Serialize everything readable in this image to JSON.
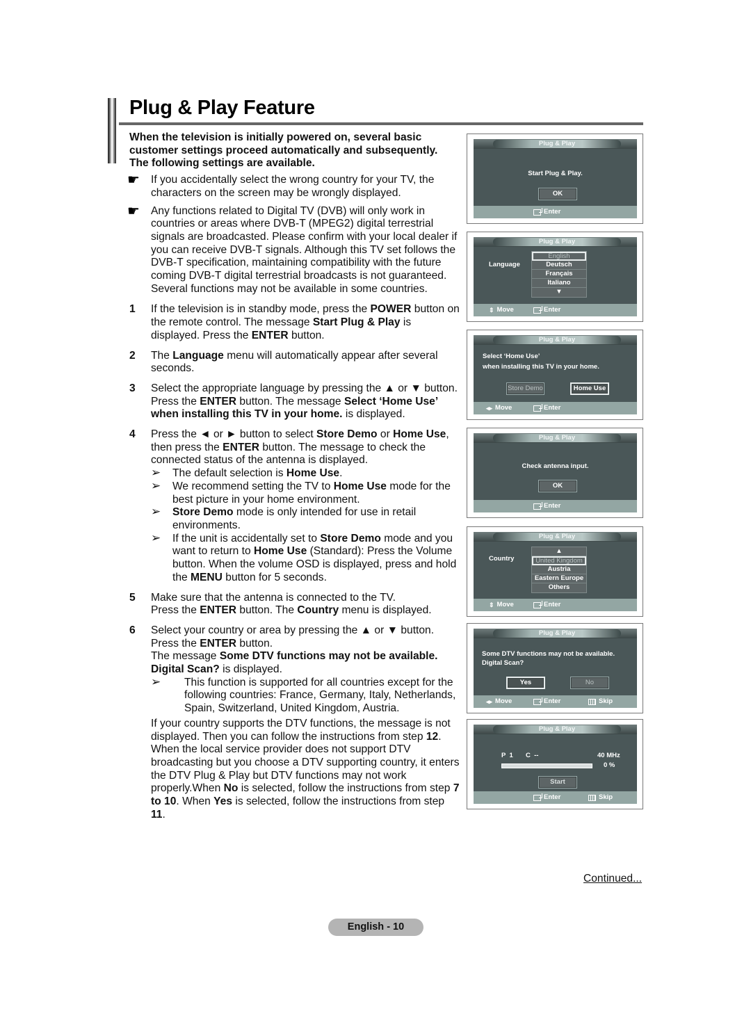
{
  "page": {
    "title": "Plug & Play Feature",
    "intro": "When the television is initially powered on, several basic customer settings proceed automatically and subsequently. The following settings are available.",
    "notes": [
      "If you accidentally select the wrong country for your TV, the characters on the screen may be wrongly displayed.",
      "Any functions related to Digital TV (DVB) will only work in countries or areas where DVB-T (MPEG2) digital terrestrial signals are broadcasted. Please confirm with your local dealer if you can receive DVB-T signals. Although this TV set follows the DVB-T specification, maintaining compatibility with the future coming DVB-T digital terrestrial broadcasts is not guaranteed. Several functions may not be available in some countries."
    ],
    "note_icon": "pointing-hand-icon",
    "steps": {
      "s1": {
        "num": "1",
        "a": "If the television is in standby mode, press the ",
        "b1": "POWER",
        "c": " button on the remote control. The message ",
        "b2": "Start Plug & Play",
        "d": " is displayed. Press the ",
        "b3": "ENTER",
        "e": " button."
      },
      "s2": {
        "num": "2",
        "a": "The ",
        "b1": "Language",
        "c": " menu will automatically appear after several seconds."
      },
      "s3": {
        "num": "3",
        "a": "Select the appropriate language by pressing the ▲ or ▼ button.",
        "p2a": "Press the ",
        "b1": "ENTER",
        "p2b": " button. The message ",
        "b2": "Select ‘Home Use’ when installing this TV in your home.",
        "p2c": " is displayed."
      },
      "s4": {
        "num": "4",
        "a": "Press the ◄ or ► button to select ",
        "b1": "Store Demo",
        "c": " or ",
        "b2": "Home Use",
        "d": ", then press the ",
        "b3": "ENTER",
        "e": " button. The message to check the connected status of the antenna is displayed.",
        "subs": {
          "n1": {
            "a": "The default selection is ",
            "b": "Home Use",
            "c": "."
          },
          "n2": {
            "a": "We recommend setting the TV to ",
            "b": "Home Use",
            "c": " mode for the best picture in your home environment."
          },
          "n3": {
            "b": "Store Demo",
            "c": " mode is only intended for use in retail environments."
          },
          "n4": {
            "a": "If the unit is accidentally set to ",
            "b1": "Store Demo",
            "c": " mode and you want to return to ",
            "b2": "Home Use",
            "d": " (Standard): Press the Volume button. When the volume OSD is displayed, press and hold the ",
            "b3": "MENU",
            "e": " button for 5 seconds."
          }
        }
      },
      "s5": {
        "num": "5",
        "a": "Make sure that the antenna is connected to the TV.",
        "p2a": "Press the ",
        "b1": "ENTER",
        "p2b": " button. The ",
        "b2": "Country",
        "p2c": " menu is displayed."
      },
      "s6": {
        "num": "6",
        "a": "Select your country or area by pressing the ▲ or ▼ button.",
        "p2a": "Press the ",
        "b1": "ENTER",
        "p2b": " button.",
        "p3a": "The message ",
        "b2": "Some DTV functions may not be available. Digital Scan?",
        "p3b": " is displayed.",
        "sub": "This function is supported for all countries except for the following countries: France, Germany, Italy, Netherlands, Spain, Switzerland, United Kingdom, Austria.",
        "para": {
          "a": "If your country supports the DTV functions, the message is not displayed. Then you can follow the instructions from step ",
          "b1": "12",
          "c": ". When the local service provider does not support DTV broadcasting but you choose a DTV supporting country, it enters the DTV Plug & Play but DTV functions may not work properly.When ",
          "b2": "No",
          "d": " is selected, follow the instructions from step ",
          "b3": "7 to 10",
          "e": ". When ",
          "b4": "Yes",
          "f": " is selected, follow the instructions from step ",
          "b5": "11",
          "g": "."
        }
      }
    },
    "arrow_glyph": "➢",
    "continued": "Continued...",
    "page_label": "English - 10"
  },
  "osd": {
    "header": "Plug & Play",
    "footer": {
      "move": "Move",
      "enter": "Enter",
      "skip": "Skip"
    },
    "panel1": {
      "message": "Start Plug & Play.",
      "ok": "OK"
    },
    "panel2": {
      "label": "Language",
      "options": [
        "English",
        "Deutsch",
        "Français",
        "Italiano",
        "▼"
      ],
      "selected": "English"
    },
    "panel3": {
      "line1": "Select ‘Home Use’",
      "line2": "when installing this TV in your home.",
      "store_demo": "Store Demo",
      "home_use": "Home Use",
      "selected": "Home Use"
    },
    "panel4": {
      "message": "Check antenna input.",
      "ok": "OK"
    },
    "panel5": {
      "label": "Country",
      "options": [
        "▲",
        "United Kingdom",
        "Austria",
        "Eastern Europe",
        "Others"
      ],
      "selected": "United Kingdom"
    },
    "panel6": {
      "line1": "Some DTV functions may not be available.",
      "line2": "Digital Scan?",
      "yes": "Yes",
      "no": "No",
      "selected": "Yes"
    },
    "panel7": {
      "program": "P  1",
      "channel": "C  --",
      "frequency": "40 MHz",
      "progress_label": "0 %",
      "progress_percent": 0,
      "start": "Start"
    }
  }
}
